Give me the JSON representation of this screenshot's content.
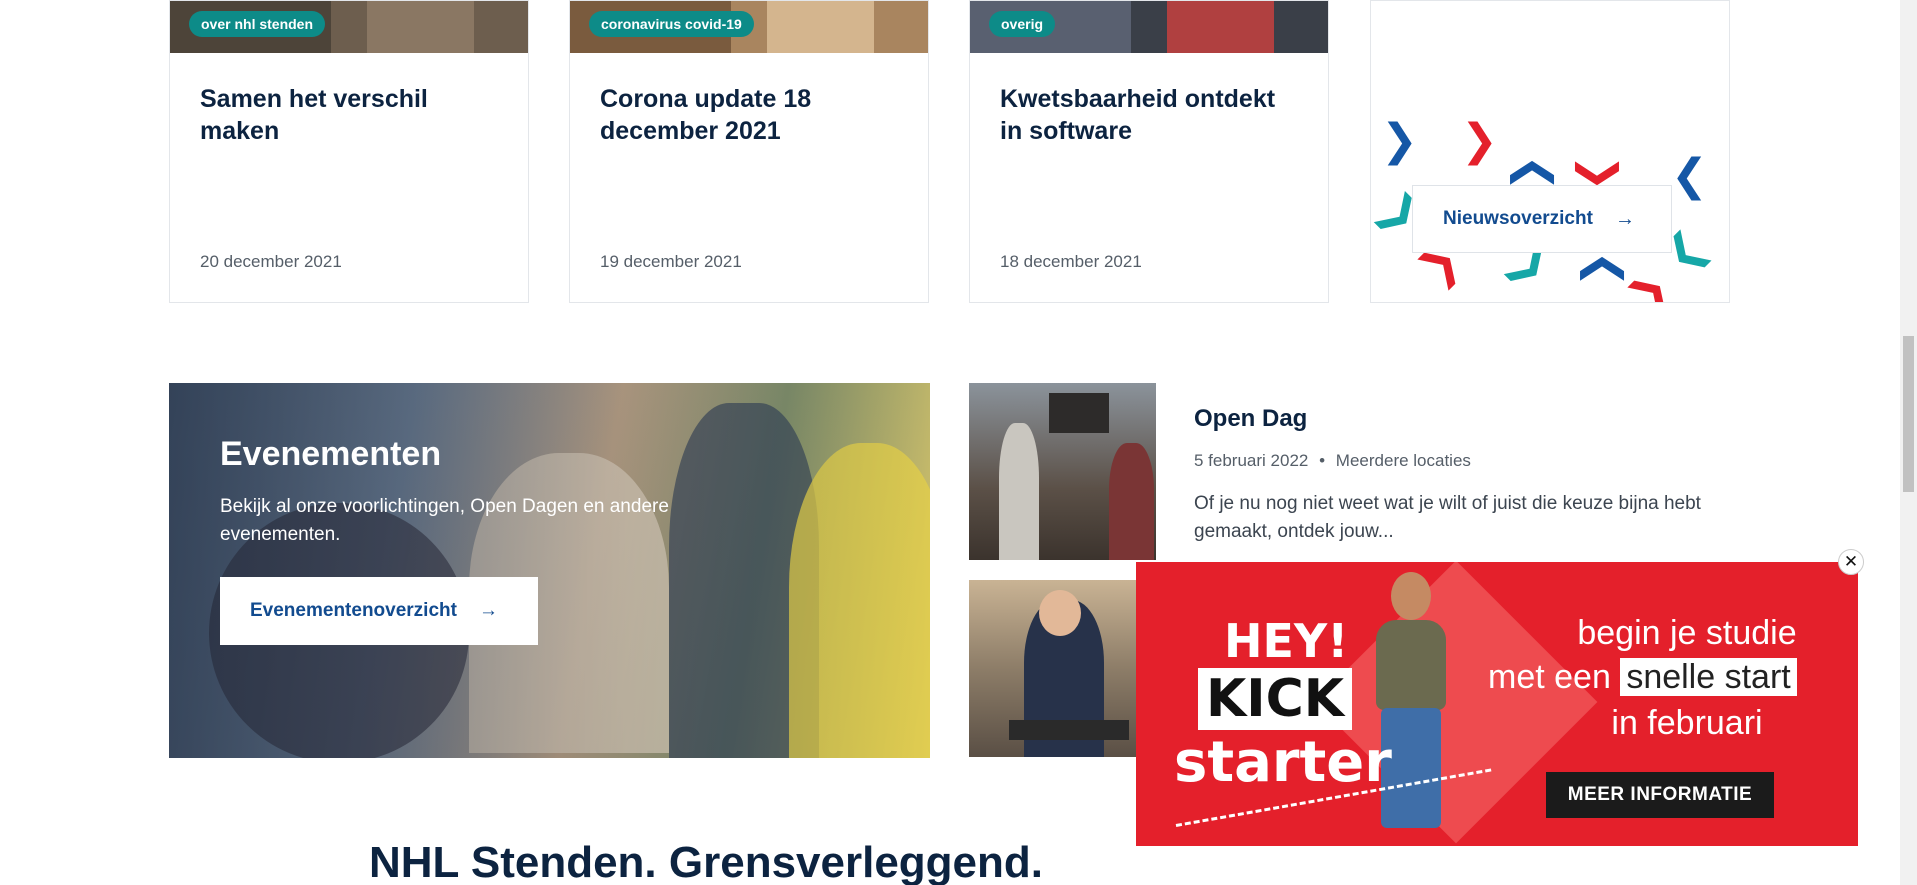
{
  "news": {
    "cards": [
      {
        "tag": "over nhl stenden",
        "title": "Samen het verschil maken",
        "date": "20 december 2021"
      },
      {
        "tag": "coronavirus covid-19",
        "title": "Corona update 18 december 2021",
        "date": "19 december 2021"
      },
      {
        "tag": "overig",
        "title": "Kwetsbaarheid ontdekt in software",
        "date": "18 december 2021"
      }
    ],
    "overview_label": "Nieuwsoverzicht",
    "arrow": "→"
  },
  "events": {
    "title": "Evenementen",
    "description": "Bekijk al onze voorlichtingen, Open Dagen en andere evenementen.",
    "button_label": "Evenementenoverzicht",
    "arrow": "→",
    "items": [
      {
        "title": "Open Dag",
        "date": "5 februari 2022",
        "separator": "•",
        "location": "Meerdere locaties",
        "description": "Of je nu nog niet weet wat je wilt of juist die keuze bijna hebt gemaakt, ontdek jouw..."
      }
    ]
  },
  "slogan": "NHL Stenden. Grensverleggend.",
  "popup": {
    "hey": "HEY!",
    "kick": "KICK",
    "starter": "starter",
    "line1": "begin je studie",
    "line2_pre": "met een",
    "line2_highlight": "snelle start",
    "line3": "in februari",
    "cta": "MEER INFORMATIE",
    "close": "✕"
  },
  "colors": {
    "navy": "#0c2340",
    "teal": "#0d8b88",
    "link_blue": "#124b8f",
    "popup_red": "#e4202b"
  }
}
